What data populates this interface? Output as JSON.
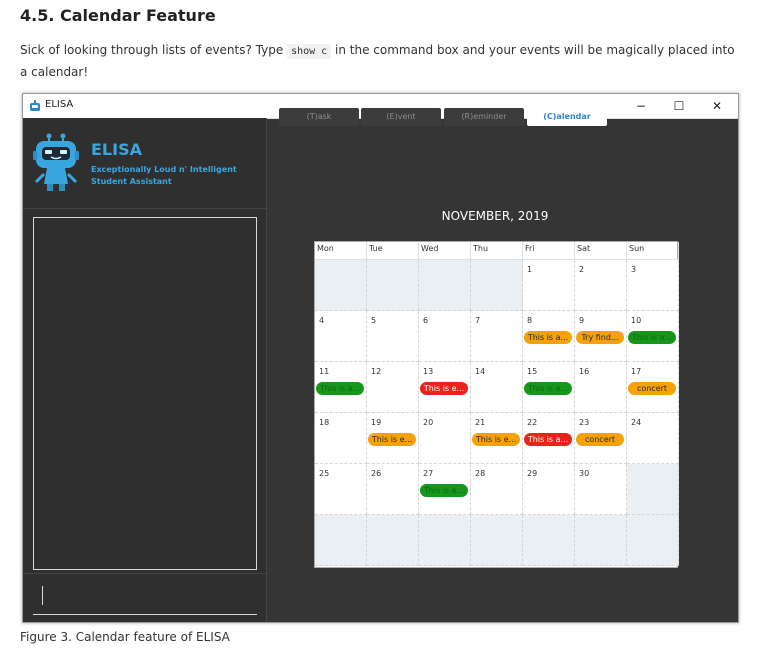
{
  "doc": {
    "title": "4.5. Calendar Feature",
    "intro_before": "Sick of looking through lists of events? Type ",
    "intro_code": "show c",
    "intro_after": " in the command box and your events will be magically placed into a calendar!",
    "caption": "Figure 3. Calendar feature of ELISA"
  },
  "window": {
    "title": "ELISA",
    "controls": [
      "−",
      "☐",
      "✕"
    ]
  },
  "sidebar": {
    "brand": "ELISA",
    "subtitle_line1": "Exceptionally Loud n' Intelligent",
    "subtitle_line2": "Student Assistant",
    "command_value": ""
  },
  "tabs": [
    {
      "label": "(T)ask",
      "active": false
    },
    {
      "label": "(E)vent",
      "active": false
    },
    {
      "label": "(R)eminder",
      "active": false
    },
    {
      "label": "(C)alendar",
      "active": true
    }
  ],
  "calendar": {
    "month_title": "NOVEMBER, 2019",
    "weekdays": [
      "Mon",
      "Tue",
      "Wed",
      "Thu",
      "Fri",
      "Sat",
      "Sun"
    ],
    "weeks": [
      [
        null,
        null,
        null,
        null,
        {
          "day": "1"
        },
        {
          "day": "2"
        },
        {
          "day": "3"
        }
      ],
      [
        {
          "day": "4"
        },
        {
          "day": "5"
        },
        {
          "day": "6"
        },
        {
          "day": "7"
        },
        {
          "day": "8",
          "event": {
            "text": "This is a...",
            "color": "orange"
          }
        },
        {
          "day": "9",
          "event": {
            "text": "Try find...",
            "color": "orange"
          }
        },
        {
          "day": "10",
          "event": {
            "text": "This is a...",
            "color": "green"
          }
        }
      ],
      [
        {
          "day": "11",
          "event": {
            "text": "This is a...",
            "color": "green"
          }
        },
        {
          "day": "12"
        },
        {
          "day": "13",
          "event": {
            "text": "This is e...",
            "color": "red"
          }
        },
        {
          "day": "14"
        },
        {
          "day": "15",
          "event": {
            "text": "This is e...",
            "color": "green"
          }
        },
        {
          "day": "16"
        },
        {
          "day": "17",
          "event": {
            "text": "concert",
            "color": "orange"
          }
        }
      ],
      [
        {
          "day": "18"
        },
        {
          "day": "19",
          "event": {
            "text": "This is e...",
            "color": "orange"
          }
        },
        {
          "day": "20"
        },
        {
          "day": "21",
          "event": {
            "text": "This is e...",
            "color": "orange"
          }
        },
        {
          "day": "22",
          "event": {
            "text": "This is a...",
            "color": "red"
          }
        },
        {
          "day": "23",
          "event": {
            "text": "concert",
            "color": "orange"
          }
        },
        {
          "day": "24"
        }
      ],
      [
        {
          "day": "25"
        },
        {
          "day": "26"
        },
        {
          "day": "27",
          "event": {
            "text": "This is e...",
            "color": "green"
          }
        },
        {
          "day": "28"
        },
        {
          "day": "29"
        },
        {
          "day": "30"
        },
        null
      ],
      [
        null,
        null,
        null,
        null,
        null,
        null,
        null
      ]
    ]
  },
  "colors": {
    "orange": "#f5a10a",
    "red": "#e8231c",
    "green": "#16961b",
    "accent": "#3aa6e0",
    "app_bg": "#353535"
  },
  "icons": {
    "window_icon": "robot-icon",
    "mascot": "robot-mascot"
  }
}
